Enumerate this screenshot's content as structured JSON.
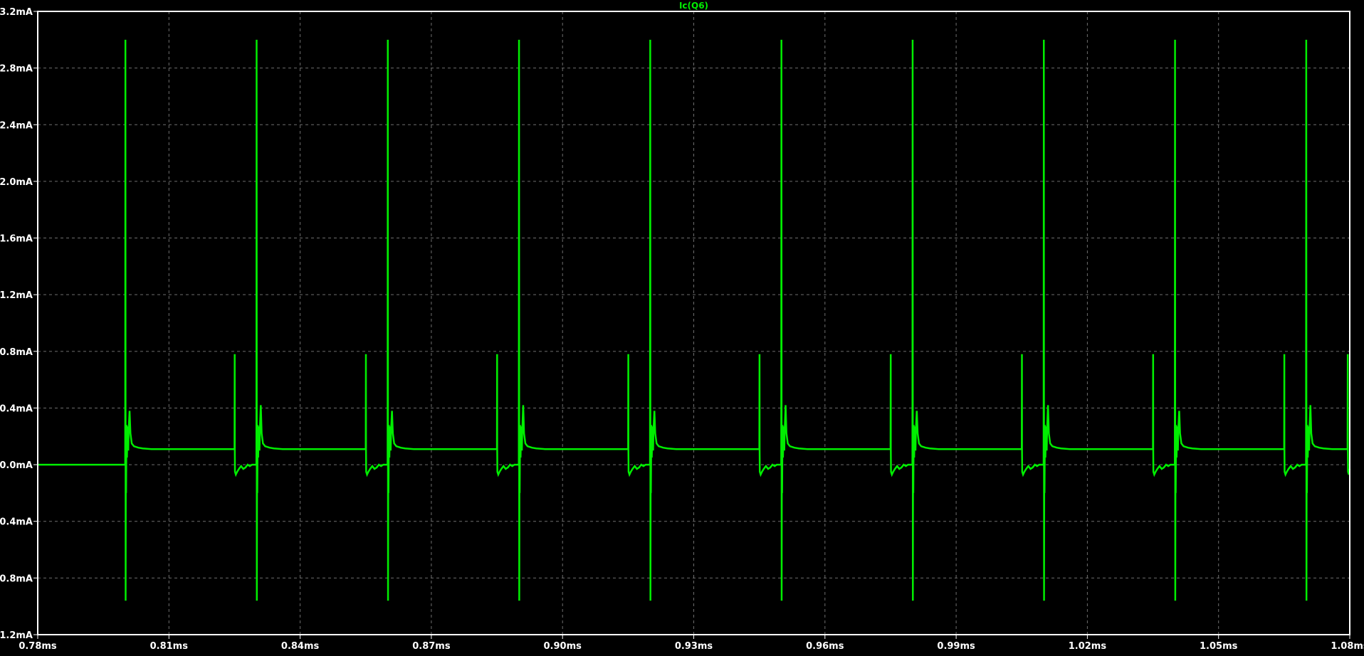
{
  "window": {
    "background": "#000000",
    "grid_color": "#6e6e6e",
    "frame_color": "#ffffff",
    "label_color": "#ffffff"
  },
  "chart_data": {
    "type": "line",
    "title": "",
    "xlabel": "",
    "ylabel": "",
    "xlim": [
      0.78,
      1.08
    ],
    "ylim": [
      -1.2,
      3.2
    ],
    "grid": true,
    "legend": "top-center",
    "x_ticks": [
      0.78,
      0.81,
      0.84,
      0.87,
      0.9,
      0.93,
      0.96,
      0.99,
      1.02,
      1.05,
      1.08
    ],
    "x_tick_labels": [
      "0.78ms",
      "0.81ms",
      "0.84ms",
      "0.87ms",
      "0.90ms",
      "0.93ms",
      "0.96ms",
      "0.99ms",
      "1.02ms",
      "1.05ms",
      "1.08ms"
    ],
    "y_ticks": [
      3.2,
      2.8,
      2.4,
      2.0,
      1.6,
      1.2,
      0.8,
      0.4,
      0.0,
      -0.4,
      -0.8,
      -1.2
    ],
    "y_tick_labels": [
      "3.2mA",
      "2.8mA",
      "2.4mA",
      "2.0mA",
      "1.6mA",
      "1.2mA",
      "0.8mA",
      "0.4mA",
      "0.0mA",
      "-0.4mA",
      "-0.8mA",
      "-1.2mA"
    ],
    "series": [
      {
        "name": "Ic(Q6)",
        "color": "#00ee00",
        "x_units": "ms",
        "y_units": "mA",
        "x": [
          0.78,
          0.8,
          0.80005,
          0.8001,
          0.80015,
          0.8002,
          0.8003,
          0.8004,
          0.8005,
          0.8006,
          0.8007,
          0.8008,
          0.801,
          0.8012,
          0.8015,
          0.802,
          0.803,
          0.804,
          0.806,
          0.81,
          0.815,
          0.82,
          0.825,
          0.82504,
          0.82506,
          0.8251,
          0.8253,
          0.8256,
          0.826,
          0.8265,
          0.827,
          0.8275,
          0.828,
          0.8285,
          0.829,
          0.83,
          0.83,
          0.83005,
          0.8301,
          0.83015,
          0.8302,
          0.8303,
          0.8304,
          0.8305,
          0.8306,
          0.8307,
          0.8308,
          0.831,
          0.8312,
          0.8315,
          0.832,
          0.833,
          0.834,
          0.836,
          0.84,
          0.845,
          0.85,
          0.855,
          0.85504,
          0.85506,
          0.8551,
          0.8553,
          0.8556,
          0.856,
          0.8565,
          0.857,
          0.8575,
          0.858,
          0.8585,
          0.859,
          0.86,
          0.86,
          0.86005,
          0.8601,
          0.86015,
          0.8602,
          0.8603,
          0.8604,
          0.8605,
          0.8606,
          0.8607,
          0.8608,
          0.861,
          0.8612,
          0.8615,
          0.862,
          0.863,
          0.864,
          0.866,
          0.87,
          0.875,
          0.88,
          0.885,
          0.88504,
          0.88506,
          0.8851,
          0.8853,
          0.8856,
          0.886,
          0.8865,
          0.887,
          0.8875,
          0.888,
          0.8885,
          0.889,
          0.89,
          0.89,
          0.89005,
          0.8901,
          0.89015,
          0.8902,
          0.8903,
          0.8904,
          0.8905,
          0.8906,
          0.8907,
          0.8908,
          0.891,
          0.8912,
          0.8915,
          0.892,
          0.893,
          0.894,
          0.896,
          0.9,
          0.905,
          0.91,
          0.915,
          0.91504,
          0.91506,
          0.9151,
          0.9153,
          0.9156,
          0.916,
          0.9165,
          0.917,
          0.9175,
          0.918,
          0.9185,
          0.919,
          0.92,
          0.92,
          0.92005,
          0.9201,
          0.92015,
          0.9202,
          0.9203,
          0.9204,
          0.9205,
          0.9206,
          0.9207,
          0.9208,
          0.921,
          0.9212,
          0.9215,
          0.922,
          0.923,
          0.924,
          0.926,
          0.93,
          0.935,
          0.94,
          0.945,
          0.94504,
          0.94506,
          0.9451,
          0.9453,
          0.9456,
          0.946,
          0.9465,
          0.947,
          0.9475,
          0.948,
          0.9485,
          0.949,
          0.95,
          0.95,
          0.95005,
          0.9501,
          0.95015,
          0.9502,
          0.9503,
          0.9504,
          0.9505,
          0.9506,
          0.9507,
          0.9508,
          0.951,
          0.9512,
          0.9515,
          0.952,
          0.953,
          0.954,
          0.956,
          0.96,
          0.965,
          0.97,
          0.975,
          0.97504,
          0.97506,
          0.9751,
          0.9753,
          0.9756,
          0.976,
          0.9765,
          0.977,
          0.9775,
          0.978,
          0.9785,
          0.979,
          0.98,
          0.98,
          0.98005,
          0.9801,
          0.98015,
          0.9802,
          0.9803,
          0.9804,
          0.9805,
          0.9806,
          0.9807,
          0.9808,
          0.981,
          0.9812,
          0.9815,
          0.982,
          0.983,
          0.984,
          0.986,
          0.99,
          0.995,
          1.0,
          1.005,
          1.00504,
          1.00506,
          1.0051,
          1.0053,
          1.0056,
          1.006,
          1.0065,
          1.007,
          1.0075,
          1.008,
          1.0085,
          1.009,
          1.01,
          1.01,
          1.01005,
          1.0101,
          1.01015,
          1.0102,
          1.0103,
          1.0104,
          1.0105,
          1.0106,
          1.0107,
          1.0108,
          1.011,
          1.0112,
          1.0115,
          1.012,
          1.013,
          1.014,
          1.016,
          1.02,
          1.025,
          1.03,
          1.035,
          1.03504,
          1.03506,
          1.0351,
          1.0353,
          1.0356,
          1.036,
          1.0365,
          1.037,
          1.0375,
          1.038,
          1.0385,
          1.039,
          1.04,
          1.04,
          1.04005,
          1.0401,
          1.04015,
          1.0402,
          1.0403,
          1.0404,
          1.0405,
          1.0406,
          1.0407,
          1.0408,
          1.041,
          1.0412,
          1.0415,
          1.042,
          1.043,
          1.044,
          1.046,
          1.05,
          1.055,
          1.06,
          1.065,
          1.06504,
          1.06506,
          1.0651,
          1.0653,
          1.0656,
          1.066,
          1.0665,
          1.067,
          1.0675,
          1.068,
          1.0685,
          1.069,
          1.07,
          1.07,
          1.07005,
          1.0701,
          1.07015,
          1.0702,
          1.0703,
          1.0704,
          1.0705,
          1.0706,
          1.0707,
          1.0708,
          1.071,
          1.0712,
          1.0715,
          1.072,
          1.073,
          1.074,
          1.076,
          1.0795,
          1.07954,
          1.07956,
          1.0796,
          1.0798,
          1.08
        ],
        "y": [
          0.0,
          0.0,
          3.0,
          -0.96,
          0.05,
          -0.2,
          0.28,
          0.05,
          0.2,
          0.27,
          0.1,
          0.25,
          0.38,
          0.22,
          0.15,
          0.13,
          0.12,
          0.115,
          0.11,
          0.11,
          0.11,
          0.11,
          0.11,
          0.78,
          0.1,
          -0.05,
          -0.07,
          -0.05,
          -0.03,
          -0.01,
          -0.03,
          -0.02,
          0.0,
          -0.01,
          0.0,
          0.0,
          0.0,
          3.0,
          -0.96,
          0.05,
          -0.2,
          0.28,
          0.05,
          0.2,
          0.27,
          0.1,
          0.25,
          0.42,
          0.22,
          0.15,
          0.13,
          0.12,
          0.115,
          0.11,
          0.11,
          0.11,
          0.11,
          0.11,
          0.78,
          0.1,
          -0.05,
          -0.07,
          -0.05,
          -0.03,
          -0.01,
          -0.03,
          -0.02,
          0.0,
          -0.01,
          0.0,
          0.0,
          0.0,
          3.0,
          -0.96,
          0.05,
          -0.2,
          0.28,
          0.05,
          0.2,
          0.27,
          0.1,
          0.25,
          0.38,
          0.22,
          0.15,
          0.13,
          0.12,
          0.115,
          0.11,
          0.11,
          0.11,
          0.11,
          0.11,
          0.78,
          0.1,
          -0.05,
          -0.07,
          -0.05,
          -0.03,
          -0.01,
          -0.03,
          -0.02,
          0.0,
          -0.01,
          0.0,
          0.0,
          0.0,
          3.0,
          -0.96,
          0.05,
          -0.2,
          0.28,
          0.05,
          0.2,
          0.27,
          0.1,
          0.25,
          0.42,
          0.22,
          0.15,
          0.13,
          0.12,
          0.115,
          0.11,
          0.11,
          0.11,
          0.11,
          0.11,
          0.78,
          0.1,
          -0.05,
          -0.07,
          -0.05,
          -0.03,
          -0.01,
          -0.03,
          -0.02,
          0.0,
          -0.01,
          0.0,
          0.0,
          0.0,
          3.0,
          -0.96,
          0.05,
          -0.2,
          0.28,
          0.05,
          0.2,
          0.27,
          0.1,
          0.25,
          0.38,
          0.22,
          0.15,
          0.13,
          0.12,
          0.115,
          0.11,
          0.11,
          0.11,
          0.11,
          0.11,
          0.78,
          0.1,
          -0.05,
          -0.07,
          -0.05,
          -0.03,
          -0.01,
          -0.03,
          -0.02,
          0.0,
          -0.01,
          0.0,
          0.0,
          0.0,
          3.0,
          -0.96,
          0.05,
          -0.2,
          0.28,
          0.05,
          0.2,
          0.27,
          0.1,
          0.25,
          0.42,
          0.22,
          0.15,
          0.13,
          0.12,
          0.115,
          0.11,
          0.11,
          0.11,
          0.11,
          0.11,
          0.78,
          0.1,
          -0.05,
          -0.07,
          -0.05,
          -0.03,
          -0.01,
          -0.03,
          -0.02,
          0.0,
          -0.01,
          0.0,
          0.0,
          0.0,
          3.0,
          -0.96,
          0.05,
          -0.2,
          0.28,
          0.05,
          0.2,
          0.27,
          0.1,
          0.25,
          0.38,
          0.22,
          0.15,
          0.13,
          0.12,
          0.115,
          0.11,
          0.11,
          0.11,
          0.11,
          0.11,
          0.78,
          0.1,
          -0.05,
          -0.07,
          -0.05,
          -0.03,
          -0.01,
          -0.03,
          -0.02,
          0.0,
          -0.01,
          0.0,
          0.0,
          0.0,
          3.0,
          -0.96,
          0.05,
          -0.2,
          0.28,
          0.05,
          0.2,
          0.27,
          0.1,
          0.25,
          0.42,
          0.22,
          0.15,
          0.13,
          0.12,
          0.115,
          0.11,
          0.11,
          0.11,
          0.11,
          0.11,
          0.78,
          0.1,
          -0.05,
          -0.07,
          -0.05,
          -0.03,
          -0.01,
          -0.03,
          -0.02,
          0.0,
          -0.01,
          0.0,
          0.0,
          0.0,
          3.0,
          -0.96,
          0.05,
          -0.2,
          0.28,
          0.05,
          0.2,
          0.27,
          0.1,
          0.25,
          0.38,
          0.22,
          0.15,
          0.13,
          0.12,
          0.115,
          0.11,
          0.11,
          0.11,
          0.11,
          0.11,
          0.78,
          0.1,
          -0.05,
          -0.07,
          -0.05,
          -0.03,
          -0.01,
          -0.03,
          -0.02,
          0.0,
          -0.01,
          0.0,
          0.0,
          0.0,
          3.0,
          -0.96,
          0.05,
          -0.2,
          0.28,
          0.05,
          0.2,
          0.27,
          0.1,
          0.25,
          0.42,
          0.22,
          0.15,
          0.13,
          0.12,
          0.115,
          0.11,
          0.11,
          0.78,
          0.1,
          -0.05,
          -0.07,
          -0.03
        ]
      }
    ]
  }
}
